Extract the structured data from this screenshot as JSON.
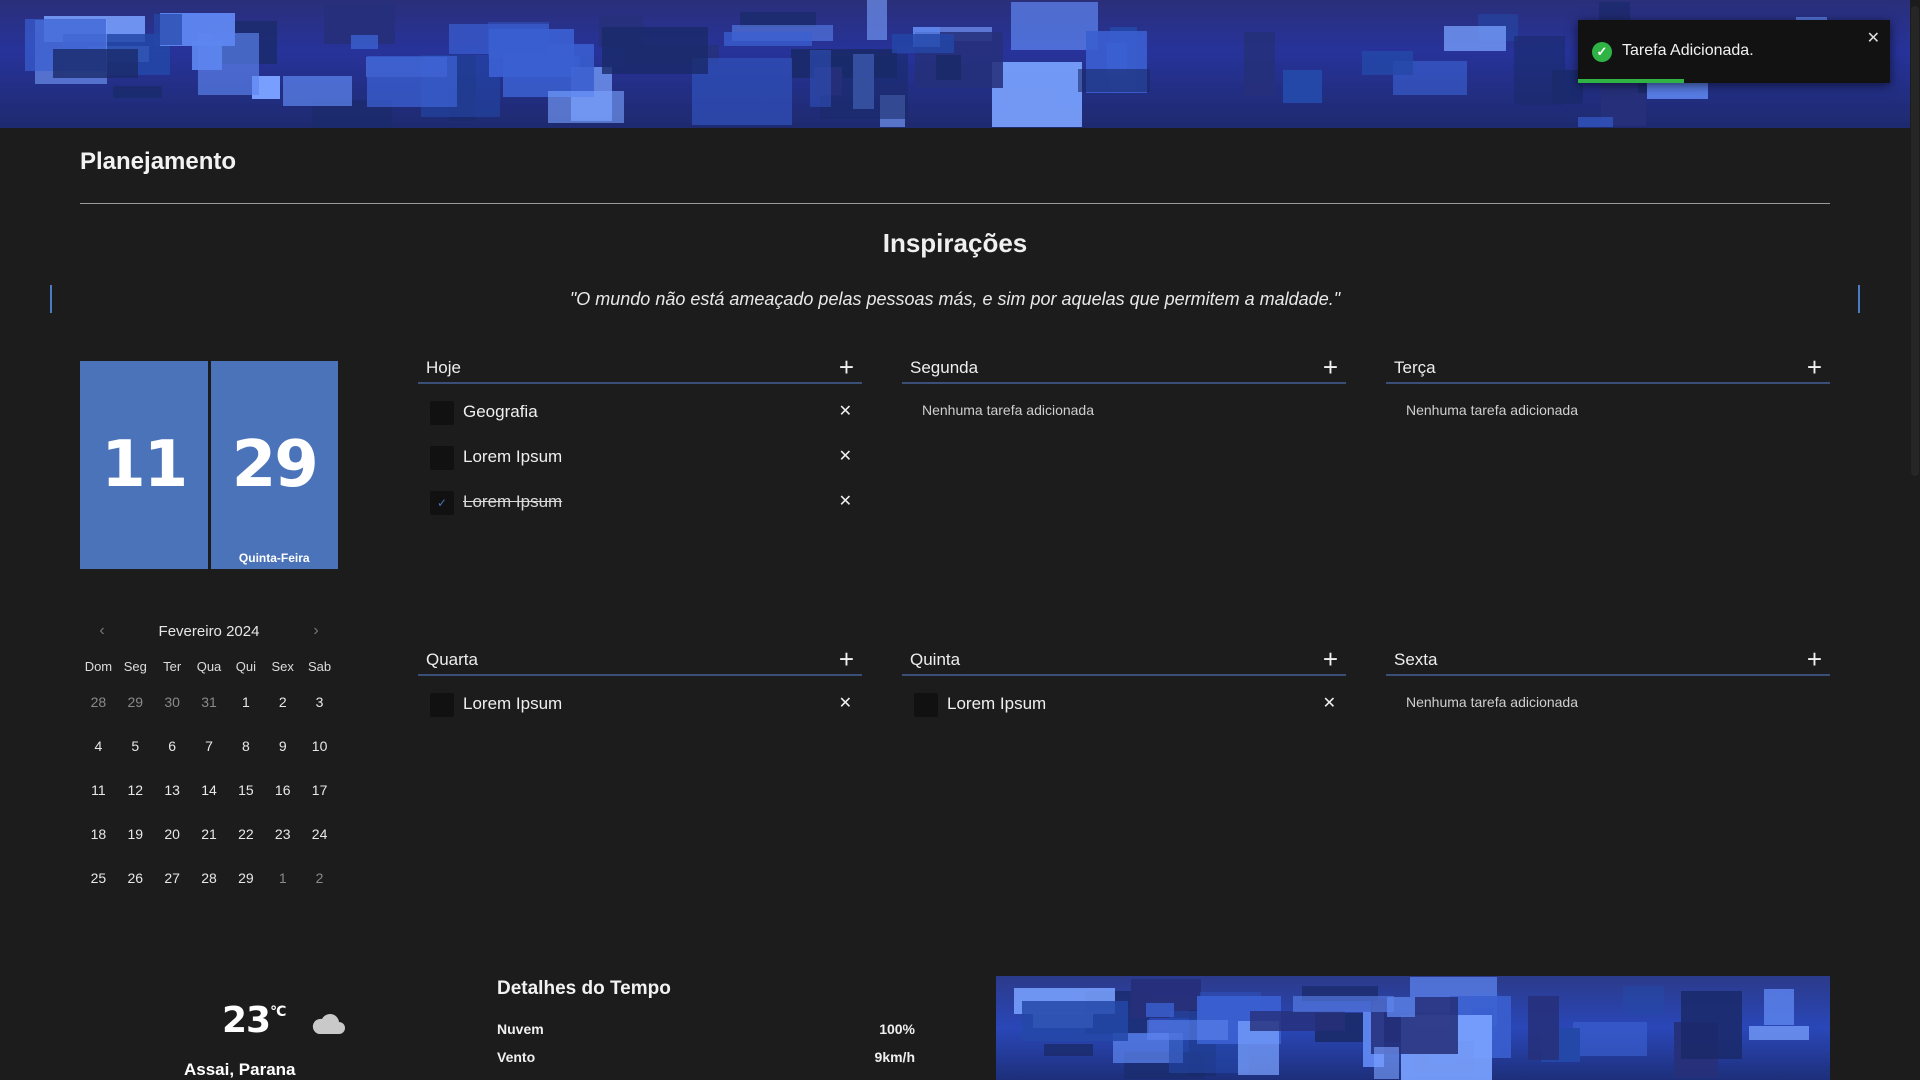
{
  "page": {
    "title": "Planejamento"
  },
  "inspiration": {
    "title": "Inspirações",
    "quote": "\"O mundo não está ameaçado pelas pessoas más, e sim por aquelas que permitem a maldade.\""
  },
  "date_tiles": {
    "day_left": "11",
    "day_right": "29",
    "weekday": "Quinta-Feira"
  },
  "calendar": {
    "month_label": "Fevereiro 2024",
    "weekdays": [
      "Dom",
      "Seg",
      "Ter",
      "Qua",
      "Qui",
      "Sex",
      "Sab"
    ],
    "weeks": [
      [
        "28",
        "29",
        "30",
        "31",
        "1",
        "2",
        "3"
      ],
      [
        "4",
        "5",
        "6",
        "7",
        "8",
        "9",
        "10"
      ],
      [
        "11",
        "12",
        "13",
        "14",
        "15",
        "16",
        "17"
      ],
      [
        "18",
        "19",
        "20",
        "21",
        "22",
        "23",
        "24"
      ],
      [
        "25",
        "26",
        "27",
        "28",
        "29",
        "1",
        "2"
      ]
    ],
    "muted": [
      [
        true,
        true,
        true,
        true,
        false,
        false,
        false
      ],
      [
        false,
        false,
        false,
        false,
        false,
        false,
        false
      ],
      [
        false,
        false,
        false,
        false,
        false,
        false,
        false
      ],
      [
        false,
        false,
        false,
        false,
        false,
        false,
        false
      ],
      [
        false,
        false,
        false,
        false,
        false,
        true,
        true
      ]
    ]
  },
  "columns": [
    {
      "title": "Hoje",
      "tasks": [
        {
          "label": "Geografia",
          "done": false
        },
        {
          "label": "Lorem Ipsum",
          "done": false
        },
        {
          "label": "Lorem Ipsum",
          "done": true
        }
      ],
      "empty_text": ""
    },
    {
      "title": "Segunda",
      "tasks": [],
      "empty_text": "Nenhuma tarefa adicionada"
    },
    {
      "title": "Terça",
      "tasks": [],
      "empty_text": "Nenhuma tarefa adicionada"
    },
    {
      "title": "Quarta",
      "tasks": [
        {
          "label": "Lorem Ipsum",
          "done": false
        }
      ],
      "empty_text": ""
    },
    {
      "title": "Quinta",
      "tasks": [
        {
          "label": "Lorem Ipsum",
          "done": false
        }
      ],
      "empty_text": ""
    },
    {
      "title": "Sexta",
      "tasks": [],
      "empty_text": "Nenhuma tarefa adicionada"
    }
  ],
  "icons": {
    "add": "plus-icon",
    "remove": "close-icon",
    "check": "check-icon",
    "prev": "chevron-left-icon",
    "next": "chevron-right-icon",
    "weather": "cloud-icon",
    "toast_status": "check-circle-icon"
  },
  "toast": {
    "message": "Tarefa Adicionada.",
    "progress": 0.34
  },
  "weather": {
    "temperature": "23",
    "unit": "°C",
    "city": "Assai, Parana",
    "details_title": "Detalhes do Tempo",
    "rows": [
      {
        "label": "Nuvem",
        "value": "100%"
      },
      {
        "label": "Vento",
        "value": "9km/h"
      }
    ]
  },
  "colors": {
    "accent": "#4a73ba",
    "success": "#2fb344",
    "background": "#1c1c1c"
  }
}
